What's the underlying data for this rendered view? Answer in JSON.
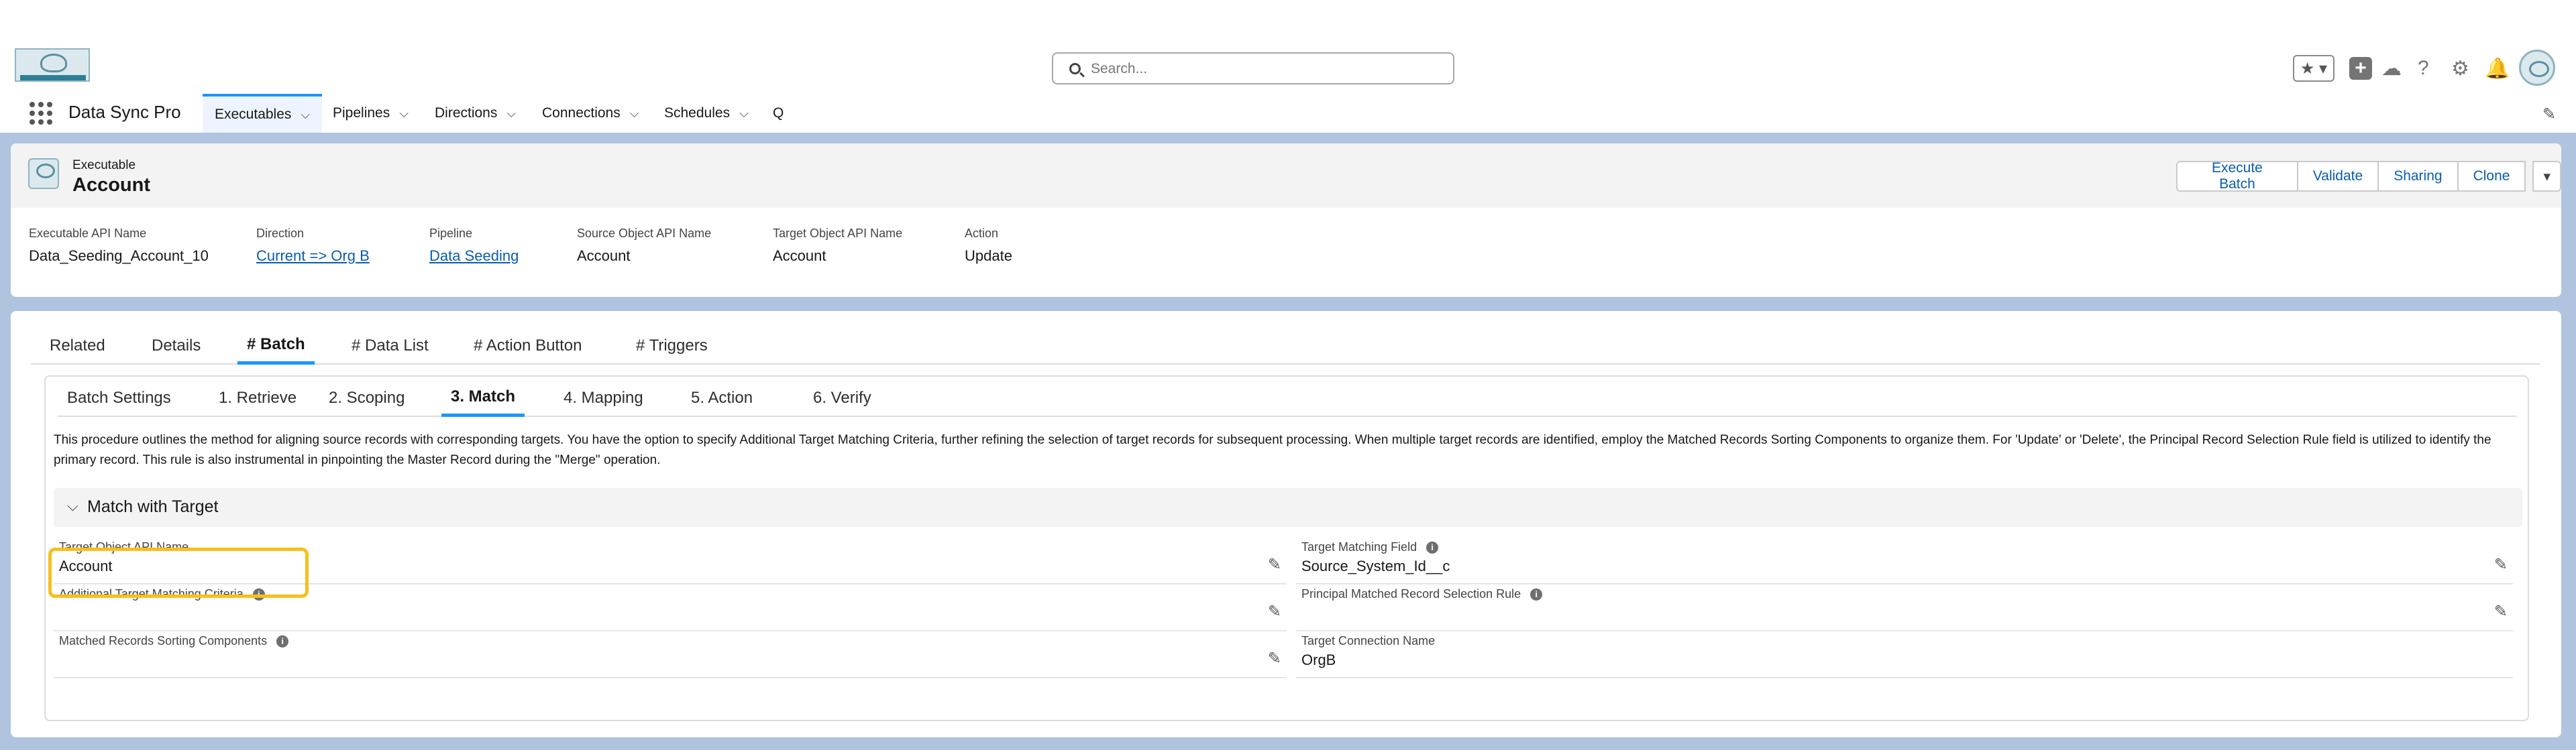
{
  "header": {
    "search_placeholder": "Search...",
    "favorites_icon": "star-icon",
    "utility_icons": [
      "add-icon",
      "cloud-icon",
      "help-icon",
      "gear-icon",
      "bell-icon"
    ]
  },
  "nav": {
    "app_name": "Data Sync Pro",
    "items": [
      {
        "label": "Executables",
        "active": true
      },
      {
        "label": "Pipelines"
      },
      {
        "label": "Directions"
      },
      {
        "label": "Connections"
      },
      {
        "label": "Schedules"
      },
      {
        "label": "Q"
      }
    ]
  },
  "record": {
    "type": "Executable",
    "name": "Account",
    "actions": [
      "Execute Batch",
      "Validate",
      "Sharing",
      "Clone"
    ],
    "fields": [
      {
        "label": "Executable API Name",
        "value": "Data_Seeding_Account_10"
      },
      {
        "label": "Direction",
        "value": "Current => Org B"
      },
      {
        "label": "Pipeline",
        "value": "Data Seeding"
      },
      {
        "label": "Source Object API Name",
        "value": "Account"
      },
      {
        "label": "Target Object API Name",
        "value": "Account"
      },
      {
        "label": "Action",
        "value": "Update"
      }
    ]
  },
  "tabs": [
    "Related",
    "Details",
    "# Batch",
    "# Data List",
    "# Action Button",
    "# Triggers"
  ],
  "subtabs": [
    "Batch Settings",
    "1. Retrieve",
    "2. Scoping",
    "3. Match",
    "4. Mapping",
    "5. Action",
    "6. Verify"
  ],
  "description": "This procedure outlines the method for aligning source records with corresponding targets. You have the option to specify Additional Target Matching Criteria, further refining the selection of target records for subsequent processing. When multiple target records are identified, employ the Matched Records Sorting Components to organize them. For 'Update' or 'Delete', the Principal Record Selection Rule field is utilized to identify the primary record. This rule is also instrumental in pinpointing the Master Record during the \"Merge\" operation.",
  "section": {
    "title": "Match with Target",
    "fields": {
      "target_object_api_name": {
        "label": "Target Object API Name",
        "value": "Account"
      },
      "additional_criteria": {
        "label": "Additional Target Matching Criteria",
        "value": ""
      },
      "sorting_components": {
        "label": "Matched Records Sorting Components",
        "value": ""
      },
      "target_matching_field": {
        "label": "Target Matching Field",
        "value": "Source_System_Id__c"
      },
      "principal_rule": {
        "label": "Principal Matched Record Selection Rule",
        "value": ""
      },
      "target_connection": {
        "label": "Target Connection Name",
        "value": "OrgB"
      }
    }
  },
  "colors": {
    "accent": "#1b96ff",
    "link": "#0b5cab",
    "highlight": "#f5bf1e",
    "background": "#b0c4df"
  }
}
